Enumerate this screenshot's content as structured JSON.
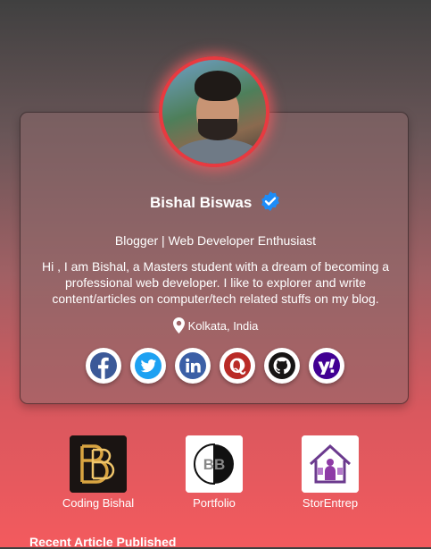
{
  "profile": {
    "name": "Bishal Biswas",
    "tagline": "Blogger | Web Developer Enthusiast",
    "bio": "Hi , I am Bishal, a Masters student with a dream of becoming a professional web developer. I like to explorer and write content/articles on computer/tech related stuffs on my blog.",
    "location": "Kolkata, India"
  },
  "socials": [
    {
      "name": "facebook-icon",
      "color": "#3b5998"
    },
    {
      "name": "twitter-icon",
      "color": "#1da1f2"
    },
    {
      "name": "linkedin-icon",
      "color": "#0a66c2"
    },
    {
      "name": "quora-icon",
      "color": "#b92b27"
    },
    {
      "name": "github-icon",
      "color": "#171515"
    },
    {
      "name": "yahoo-icon",
      "color": "#410093"
    }
  ],
  "links": [
    {
      "label": "Coding Bishal"
    },
    {
      "label": "Portfolio"
    },
    {
      "label": "StorEntrep"
    }
  ],
  "section": {
    "recent_title": "Recent Article Published"
  },
  "colors": {
    "accent": "#e83a40",
    "verified": "#1d8cf8"
  }
}
